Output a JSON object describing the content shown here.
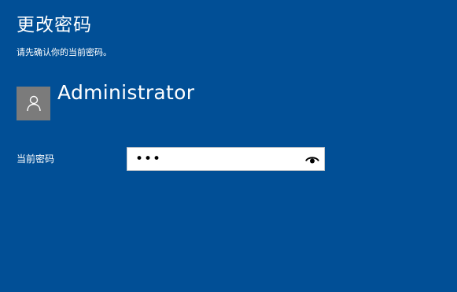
{
  "page": {
    "title": "更改密码",
    "subtitle": "请先确认你的当前密码。"
  },
  "account": {
    "avatar_icon": "user-icon",
    "username": "Administrator"
  },
  "password_field": {
    "label": "当前密码",
    "value": "•••",
    "reveal_icon": "eye-icon"
  },
  "colors": {
    "background": "#014f96",
    "avatar": "#7b7b7b",
    "input_background": "#ffffff"
  }
}
